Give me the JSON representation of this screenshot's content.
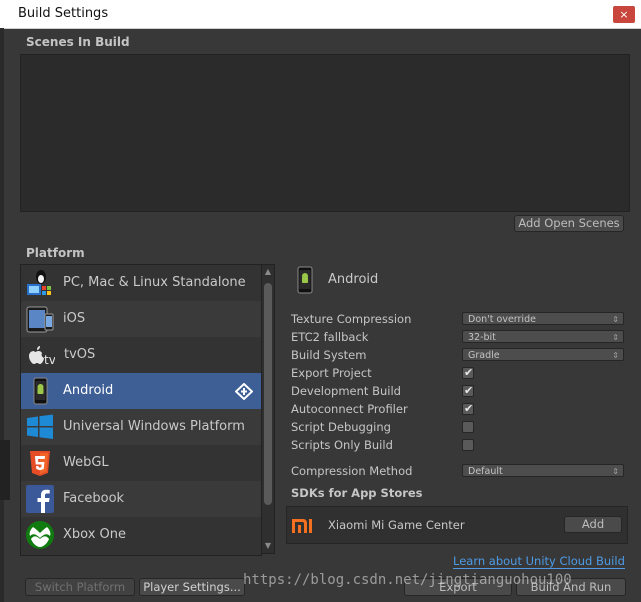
{
  "window": {
    "title": "Build Settings",
    "close_glyph": "×"
  },
  "scenes": {
    "label": "Scenes In Build",
    "add_open_scenes": "Add Open Scenes"
  },
  "platform": {
    "label": "Platform",
    "items": [
      {
        "label": "PC, Mac & Linux Standalone",
        "icon": "pc-mac-linux-icon"
      },
      {
        "label": "iOS",
        "icon": "ios-device-icon"
      },
      {
        "label": "tvOS",
        "icon": "apple-tv-icon"
      },
      {
        "label": "Android",
        "icon": "android-icon",
        "selected": true
      },
      {
        "label": "Universal Windows Platform",
        "icon": "windows-icon"
      },
      {
        "label": "WebGL",
        "icon": "html5-icon"
      },
      {
        "label": "Facebook",
        "icon": "facebook-icon"
      },
      {
        "label": "Xbox One",
        "icon": "xbox-icon"
      }
    ]
  },
  "detail": {
    "title": "Android",
    "texture_compression": {
      "label": "Texture Compression",
      "value": "Don't override"
    },
    "etc2_fallback": {
      "label": "ETC2 fallback",
      "value": "32-bit"
    },
    "build_system": {
      "label": "Build System",
      "value": "Gradle"
    },
    "export_project": {
      "label": "Export Project",
      "checked": true
    },
    "development_build": {
      "label": "Development Build",
      "checked": true
    },
    "autoconnect_profiler": {
      "label": "Autoconnect Profiler",
      "checked": true
    },
    "script_debugging": {
      "label": "Script Debugging",
      "checked": false
    },
    "scripts_only_build": {
      "label": "Scripts Only Build",
      "checked": false
    },
    "compression_method": {
      "label": "Compression Method",
      "value": "Default"
    },
    "sdks_label": "SDKs for App Stores",
    "sdk": {
      "name": "Xiaomi Mi Game Center",
      "button": "Add"
    },
    "cloud_link": "Learn about Unity Cloud Build"
  },
  "footer": {
    "switch_platform": "Switch Platform",
    "player_settings": "Player Settings...",
    "export": "Export",
    "build_and_run": "Build And Run"
  },
  "watermark": "https://blog.csdn.net/jingtianguohou100",
  "colors": {
    "selection": "#3e5f96",
    "link": "#4d9be6",
    "xiaomi_orange": "#f37021",
    "windows_blue": "#1e8ad6",
    "html5_orange": "#e44d26",
    "facebook_blue": "#3b5998",
    "xbox_green": "#107c10"
  }
}
